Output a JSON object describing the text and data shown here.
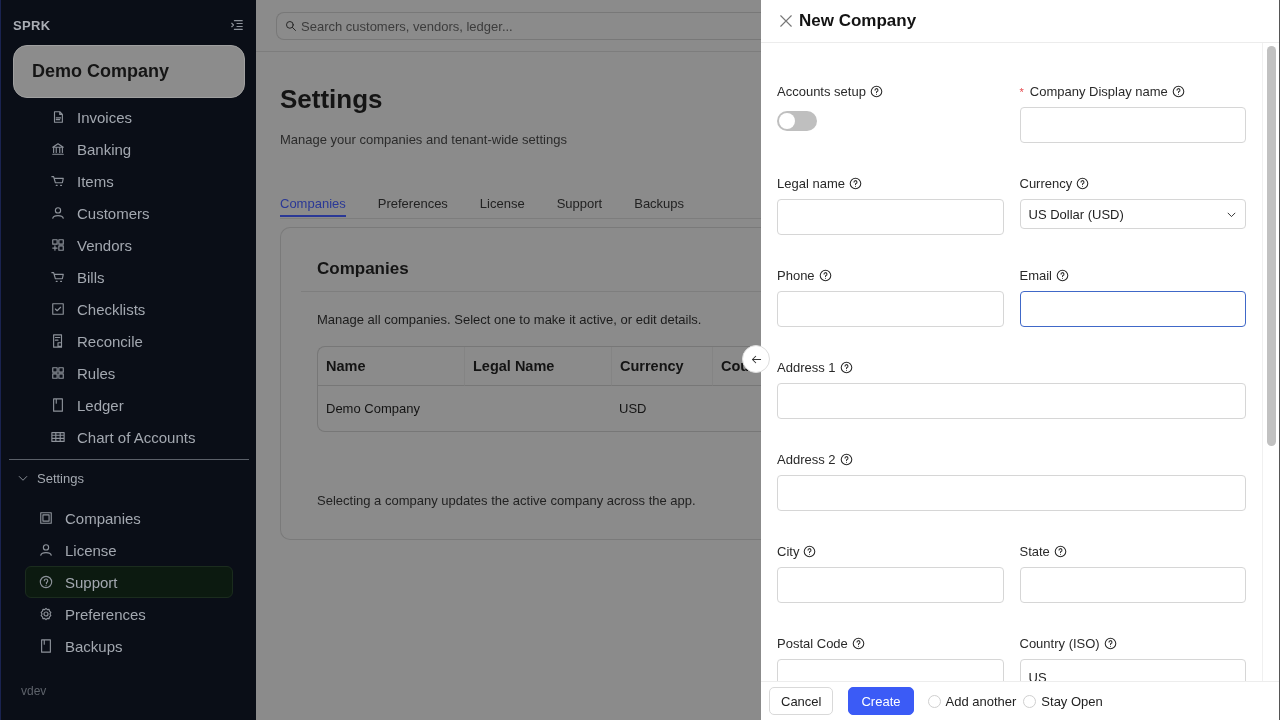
{
  "sidebar": {
    "brand": "SPRK",
    "company_button": "Demo Company",
    "items": [
      {
        "label": "Invoices",
        "selected": false
      },
      {
        "label": "Banking",
        "selected": false
      },
      {
        "label": "Items",
        "selected": false
      },
      {
        "label": "Customers",
        "selected": false
      },
      {
        "label": "Vendors",
        "selected": false
      },
      {
        "label": "Bills",
        "selected": false
      },
      {
        "label": "Checklists",
        "selected": false
      },
      {
        "label": "Reconcile",
        "selected": false
      },
      {
        "label": "Rules",
        "selected": false
      },
      {
        "label": "Ledger",
        "selected": false
      },
      {
        "label": "Chart of Accounts",
        "selected": false
      }
    ],
    "settings_group": {
      "label": "Settings",
      "expanded": true,
      "children": [
        {
          "label": "Companies",
          "selected": false
        },
        {
          "label": "License",
          "selected": false
        },
        {
          "label": "Support",
          "selected": true
        },
        {
          "label": "Preferences",
          "selected": false
        },
        {
          "label": "Backups",
          "selected": false
        }
      ]
    },
    "version": "vdev"
  },
  "main": {
    "search": {
      "placeholder": "Search customers, vendors, ledger..."
    },
    "title": "Settings",
    "subtitle": "Manage your companies and tenant-wide settings",
    "tabs": [
      {
        "label": "Companies",
        "selected": true
      },
      {
        "label": "Preferences",
        "selected": false
      },
      {
        "label": "License",
        "selected": false
      },
      {
        "label": "Support",
        "selected": false
      },
      {
        "label": "Backups",
        "selected": false
      }
    ],
    "card": {
      "title": "Companies",
      "description": "Manage all companies. Select one to make it active, or edit details.",
      "table": {
        "columns": [
          "Name",
          "Legal Name",
          "Currency",
          "Cou"
        ],
        "rows": [
          {
            "cells": [
              "Demo Company",
              null,
              "USD"
            ]
          }
        ]
      },
      "footer_note": "Selecting a company updates the active company across the app."
    }
  },
  "drawer": {
    "title": "New Company",
    "rows": [
      [
        {
          "label": "Accounts setup",
          "kind": "toggle",
          "on": false
        },
        {
          "label": "Company Display name",
          "kind": "text",
          "required_mark": "*",
          "focused": false
        }
      ],
      [
        {
          "label": "Legal name",
          "kind": "text",
          "focused": false
        },
        {
          "label": "Currency",
          "kind": "select",
          "value": "US Dollar (USD)"
        }
      ],
      [
        {
          "label": "Phone",
          "kind": "text",
          "focused": false
        },
        {
          "label": "Email",
          "kind": "text",
          "focused": true
        }
      ],
      [
        {
          "label": "Address 1",
          "kind": "text",
          "focused": false
        }
      ],
      [
        {
          "label": "Address 2",
          "kind": "text",
          "focused": false
        }
      ],
      [
        {
          "label": "City",
          "kind": "text",
          "focused": false
        },
        {
          "label": "State",
          "kind": "text",
          "focused": false
        }
      ],
      [
        {
          "label": "Postal Code",
          "kind": "text",
          "focused": false
        },
        {
          "label": "Country (ISO)",
          "kind": "text",
          "focused": false,
          "value": "US"
        }
      ]
    ],
    "footer": {
      "cancel": "Cancel",
      "create": "Create",
      "options": [
        {
          "label": "Add another",
          "checked": false
        },
        {
          "label": "Stay Open",
          "checked": false
        }
      ]
    }
  }
}
